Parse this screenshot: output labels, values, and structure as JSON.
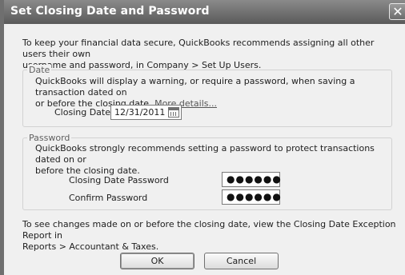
{
  "window": {
    "title": "Set Closing Date and Password",
    "close_glyph": "✕"
  },
  "intro_text_line1": "To keep your financial data secure, QuickBooks recommends assigning all other users their own",
  "intro_text_line2": "username and password, in Company > Set Up Users.",
  "date_group": {
    "label": "Date",
    "description_line1": "QuickBooks will display a warning, or require a password, when saving a transaction dated on",
    "description_line2_prefix": "or before the closing date.",
    "more_details_link": "More details...",
    "closing_date_label": "Closing Date",
    "closing_date_value": "12/31/2011",
    "calendar_icon": "calendar-icon"
  },
  "password_group": {
    "label": "Password",
    "description_line1": "QuickBooks strongly recommends setting a password to protect transactions dated on or",
    "description_line2": "before the closing date.",
    "closing_date_password_label": "Closing Date Password",
    "closing_date_password_value": "●●●●●●",
    "confirm_password_label": "Confirm Password",
    "confirm_password_value": "●●●●●●"
  },
  "footer_text_line1": "To see changes made on or before the closing date, view the Closing Date Exception Report in",
  "footer_text_line2": "Reports > Accountant & Taxes.",
  "buttons": {
    "ok": "OK",
    "cancel": "Cancel"
  }
}
